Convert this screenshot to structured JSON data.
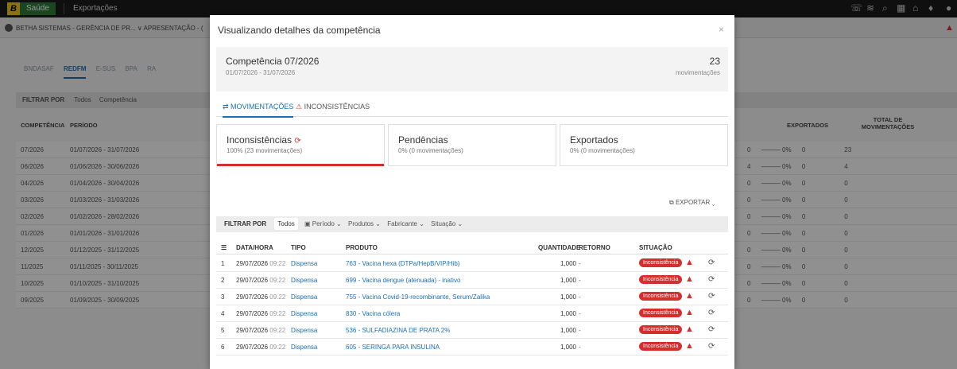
{
  "app": {
    "logo": "B",
    "module": "Saúde",
    "title": "Exportações"
  },
  "org": {
    "text": "BETHA SISTEMAS - GERÊNCIA DE PR... ∨ APRESENTAÇÃO - ("
  },
  "bg_tabs": [
    "BNDASAF",
    "REDFM",
    "E-SUS",
    "BPA",
    "RA"
  ],
  "bg_filter": {
    "label": "FILTRAR POR",
    "todos": "Todos",
    "competencia": "Competência"
  },
  "bg_headers": {
    "competencia": "COMPETÊNCIA",
    "periodo": "PERÍODO",
    "exportados": "EXPORTADOS",
    "total": "TOTAL DE MOVIMENTAÇÕES"
  },
  "bg_rows": [
    {
      "comp": "07/2026",
      "periodo": "01/07/2026 - 31/07/2026",
      "a": "0",
      "pct": "0%",
      "b": "0",
      "total": "23"
    },
    {
      "comp": "06/2026",
      "periodo": "01/06/2026 - 30/06/2026",
      "a": "4",
      "pct": "0%",
      "b": "0",
      "total": "4"
    },
    {
      "comp": "04/2026",
      "periodo": "01/04/2026 - 30/04/2026",
      "a": "0",
      "pct": "0%",
      "b": "0",
      "total": "0"
    },
    {
      "comp": "03/2026",
      "periodo": "01/03/2026 - 31/03/2026",
      "a": "0",
      "pct": "0%",
      "b": "0",
      "total": "0"
    },
    {
      "comp": "02/2026",
      "periodo": "01/02/2026 - 28/02/2026",
      "a": "0",
      "pct": "0%",
      "b": "0",
      "total": "0"
    },
    {
      "comp": "01/2026",
      "periodo": "01/01/2026 - 31/01/2026",
      "a": "0",
      "pct": "0%",
      "b": "0",
      "total": "0"
    },
    {
      "comp": "12/2025",
      "periodo": "01/12/2025 - 31/12/2025",
      "a": "0",
      "pct": "0%",
      "b": "0",
      "total": "0"
    },
    {
      "comp": "11/2025",
      "periodo": "01/11/2025 - 30/11/2025",
      "a": "0",
      "pct": "0%",
      "b": "0",
      "total": "0"
    },
    {
      "comp": "10/2025",
      "periodo": "01/10/2025 - 31/10/2025",
      "a": "0",
      "pct": "0%",
      "b": "0",
      "total": "0"
    },
    {
      "comp": "09/2025",
      "periodo": "01/09/2025 - 30/09/2025",
      "a": "0",
      "pct": "0%",
      "b": "0",
      "total": "0"
    }
  ],
  "modal": {
    "title": "Visualizando detalhes da competência",
    "close": "×",
    "competencia": "Competência 07/2026",
    "periodo": "01/07/2026 - 31/07/2026",
    "count": "23",
    "count_label": "movimentações",
    "tab_mov": "⇄ MOVIMENTAÇÕES",
    "tab_inc": "INCONSISTÊNCIAS",
    "cards": [
      {
        "title": "Inconsistências",
        "sub": "100% (23 movimentações)",
        "progress": 1.0
      },
      {
        "title": "Pendências",
        "sub": "0% (0 movimentações)",
        "progress": 0
      },
      {
        "title": "Exportados",
        "sub": "0% (0 movimentações)",
        "progress": 0
      }
    ],
    "export_label": "EXPORTAR",
    "filter": {
      "label": "FILTRAR POR",
      "todos": "Todos",
      "periodo": "Período",
      "produtos": "Produtos",
      "fabricante": "Fabricante",
      "situacao": "Situação"
    },
    "headers": {
      "datahora": "DATA/HORA",
      "tipo": "TIPO",
      "produto": "PRODUTO",
      "quantidade": "QUANTIDADE",
      "retorno": "RETORNO",
      "situacao": "SITUAÇÃO"
    },
    "rows": [
      {
        "n": "1",
        "data": "29/07/2026",
        "hora": "09:22",
        "tipo": "Dispensa",
        "produto": "763 - Vacina hexa (DTPa/HepB/VIP/Hib)",
        "qtd": "1,000",
        "ret": "-",
        "sit": "Inconsistência"
      },
      {
        "n": "2",
        "data": "29/07/2026",
        "hora": "09:22",
        "tipo": "Dispensa",
        "produto": "699 - Vacina dengue (atenuada) - inativo",
        "qtd": "1,000",
        "ret": "-",
        "sit": "Inconsistência"
      },
      {
        "n": "3",
        "data": "29/07/2026",
        "hora": "09:22",
        "tipo": "Dispensa",
        "produto": "755 - Vacina Covid-19-recombinante, Serum/Zalika",
        "qtd": "1,000",
        "ret": "-",
        "sit": "Inconsistência"
      },
      {
        "n": "4",
        "data": "29/07/2026",
        "hora": "09:22",
        "tipo": "Dispensa",
        "produto": "830 - Vacina cólera",
        "qtd": "1,000",
        "ret": "-",
        "sit": "Inconsistência"
      },
      {
        "n": "5",
        "data": "29/07/2026",
        "hora": "09:22",
        "tipo": "Dispensa",
        "produto": "536 - SULFADIAZINA DE PRATA 2%",
        "qtd": "1,000",
        "ret": "-",
        "sit": "Inconsistência"
      },
      {
        "n": "6",
        "data": "29/07/2026",
        "hora": "09:22",
        "tipo": "Dispensa",
        "produto": "605 - SERINGA PARA INSULINA",
        "qtd": "1,000",
        "ret": "-",
        "sit": "Inconsistência"
      }
    ]
  },
  "colors": {
    "accent": "#1b6fb5",
    "danger": "#d32f2f",
    "module": "#2e7a3a"
  }
}
